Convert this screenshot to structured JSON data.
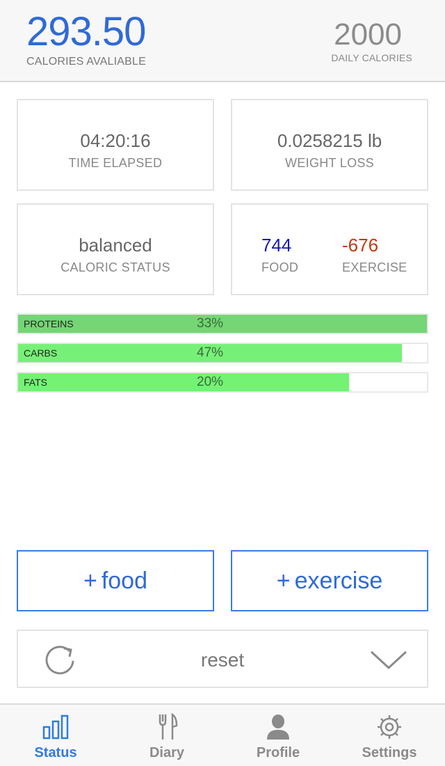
{
  "header": {
    "calories_available": "293.50",
    "calories_available_label": "CALORIES AVALIABLE",
    "daily_calories": "2000",
    "daily_calories_label": "DAILY CALORIES"
  },
  "stats": {
    "time_elapsed": {
      "value": "04:20:16",
      "label": "TIME ELAPSED"
    },
    "weight_loss": {
      "value": "0.0258215 lb",
      "label": "WEIGHT LOSS"
    },
    "caloric_status": {
      "value": "balanced",
      "label": "CALORIC STATUS"
    },
    "food": {
      "value": "744",
      "label": "FOOD"
    },
    "exercise": {
      "value": "-676",
      "label": "EXERCISE"
    }
  },
  "macros": [
    {
      "name": "PROTEINS",
      "percent": "33%",
      "fill_fraction": 1.0
    },
    {
      "name": "CARBS",
      "percent": "47%",
      "fill_fraction": 0.94
    },
    {
      "name": "FATS",
      "percent": "20%",
      "fill_fraction": 0.81
    }
  ],
  "actions": {
    "add_food": "food",
    "add_exercise": "exercise",
    "plus": "+",
    "reset": "reset"
  },
  "icons": {
    "reset": "refresh-icon",
    "collapse": "chevron-down-icon",
    "status": "bar-chart-icon",
    "diary": "fork-knife-icon",
    "profile": "person-icon",
    "settings": "gear-icon"
  },
  "tabs": [
    {
      "label": "Status",
      "active": true
    },
    {
      "label": "Diary",
      "active": false
    },
    {
      "label": "Profile",
      "active": false
    },
    {
      "label": "Settings",
      "active": false
    }
  ],
  "colors": {
    "accent": "#2f6ad6",
    "food_value": "#1a1aa6",
    "exercise_value": "#c23a10",
    "macro_green": "#77f077",
    "tab_active": "#2f7be0"
  }
}
